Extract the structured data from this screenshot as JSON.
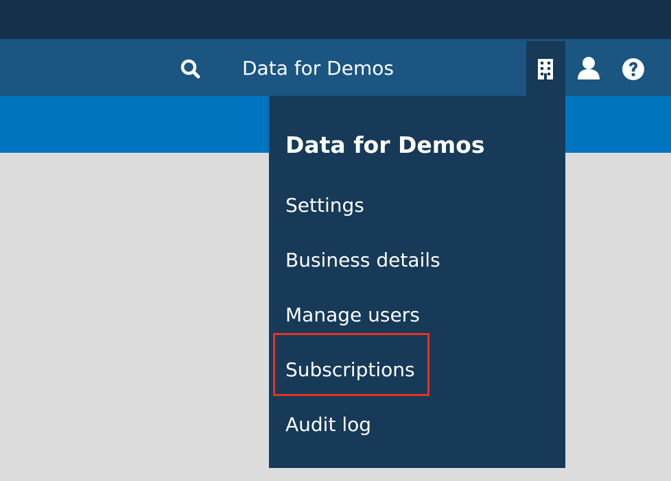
{
  "header": {
    "org_name": "Data for Demos",
    "icons": {
      "search": "search-icon",
      "organization": "building-icon",
      "user": "user-icon",
      "help": "question-circle-icon"
    }
  },
  "dropdown": {
    "title": "Data for Demos",
    "items": [
      {
        "label": "Settings"
      },
      {
        "label": "Business details"
      },
      {
        "label": "Manage users"
      },
      {
        "label": "Subscriptions",
        "highlighted": true
      },
      {
        "label": "Audit log"
      }
    ]
  },
  "colors": {
    "top_bar": "#14304a",
    "nav_bar": "#1b5582",
    "sub_bar": "#0075bf",
    "dropdown_bg": "#163a58",
    "highlight_border": "#e8321f",
    "page_bg": "#dcdcdc"
  }
}
